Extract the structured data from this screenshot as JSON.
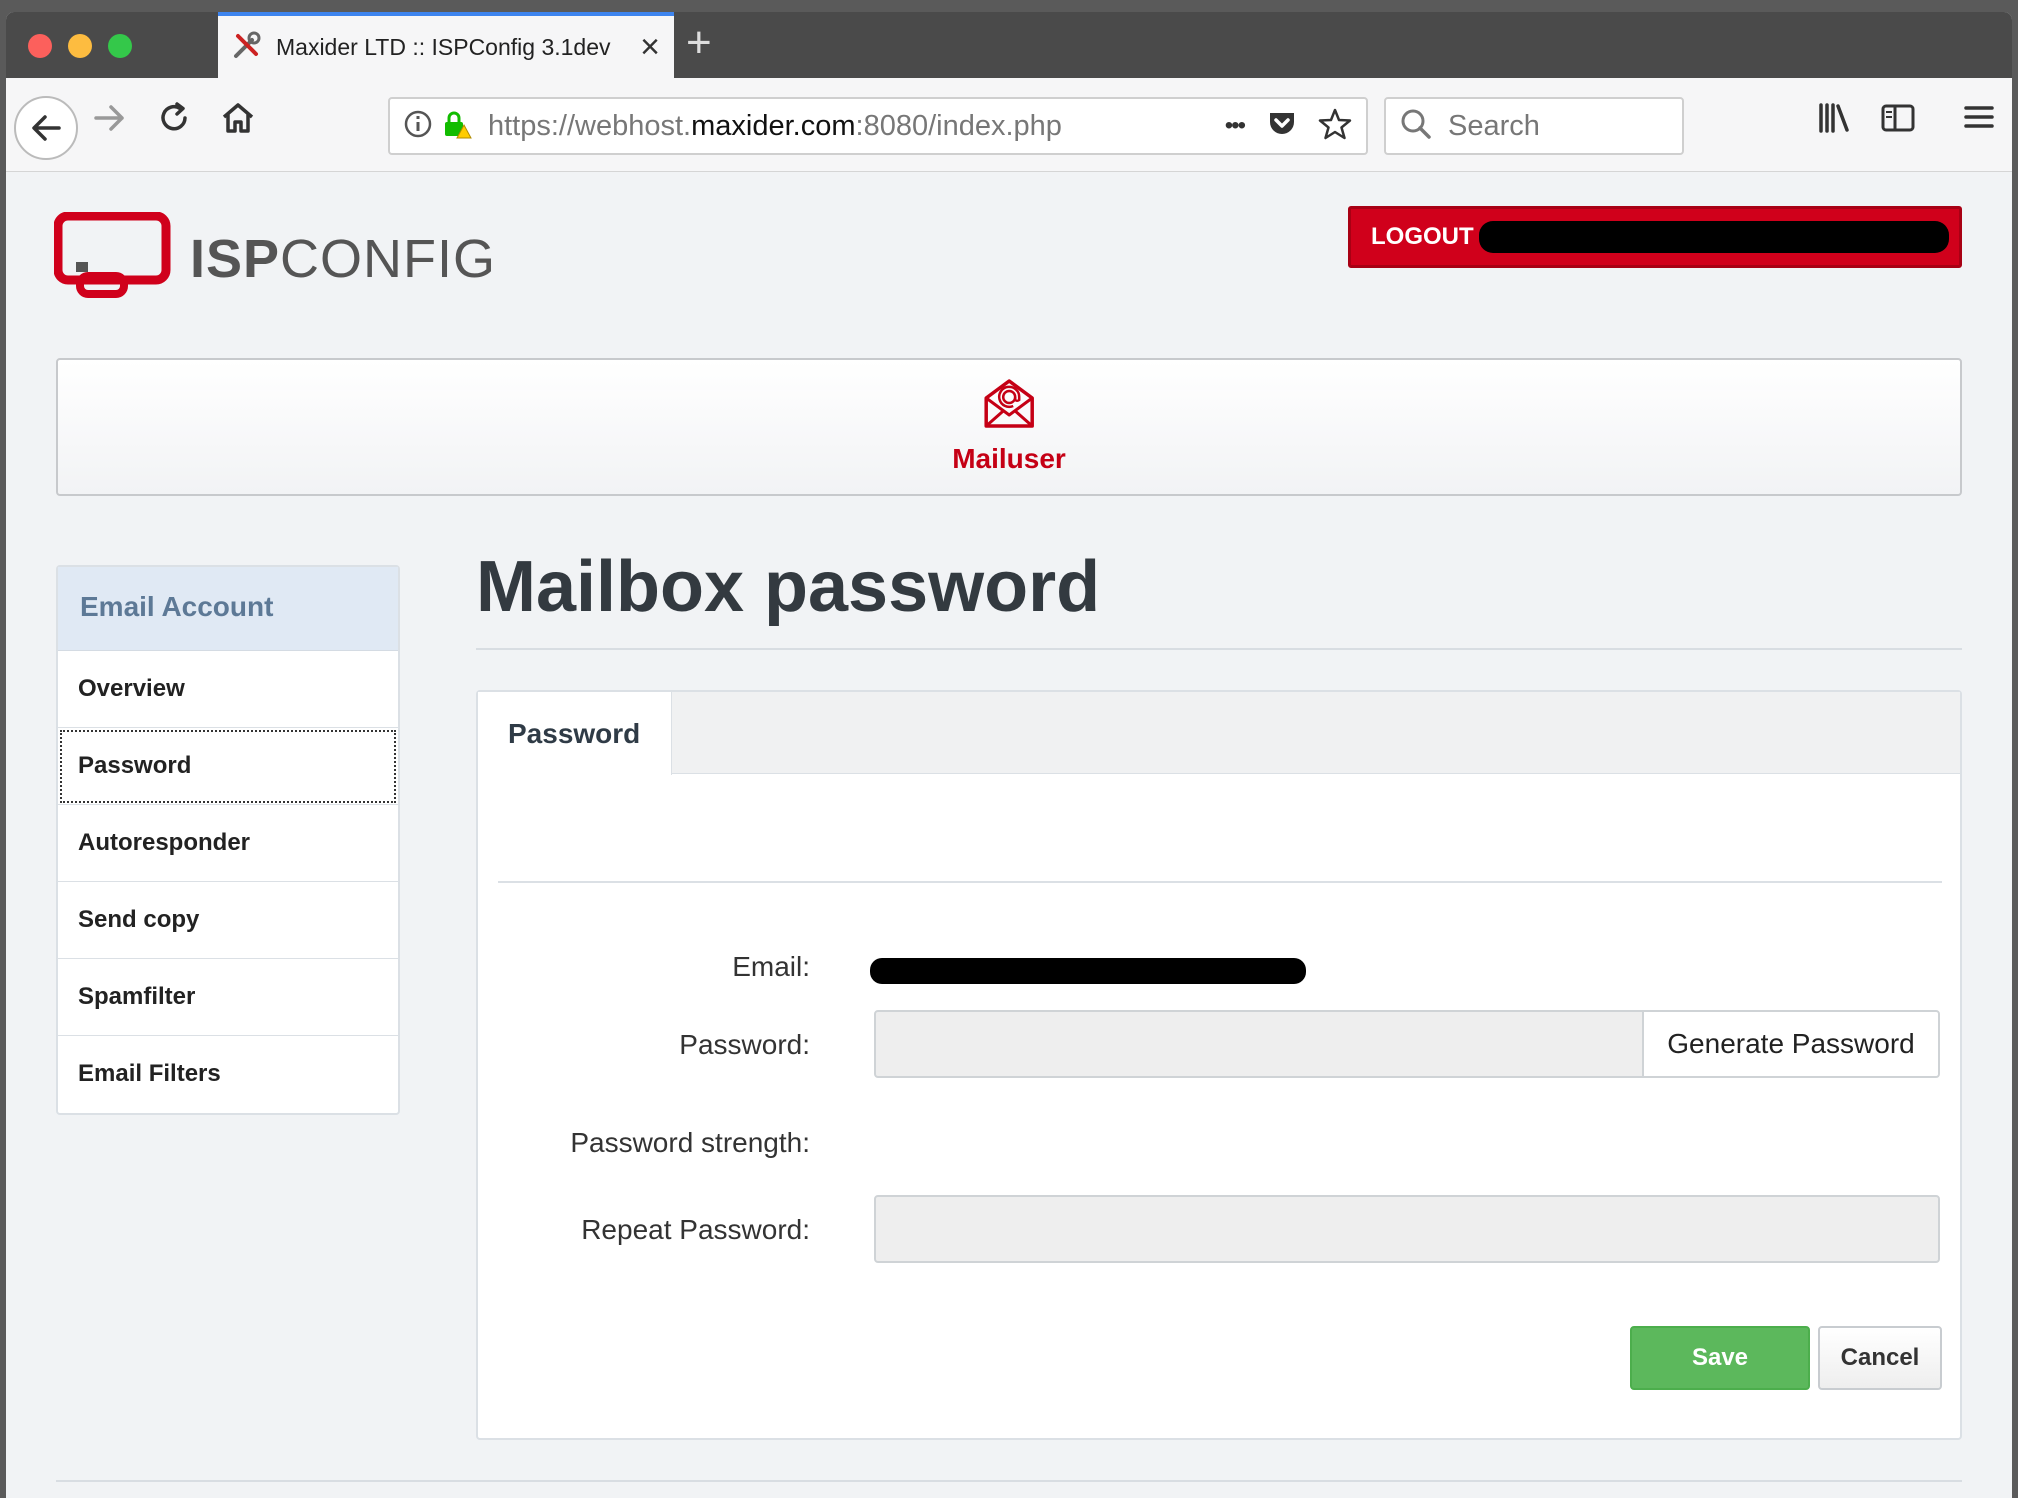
{
  "browser": {
    "tab_title": "Maxider LTD :: ISPConfig 3.1dev",
    "url_prefix": "https://webhost.",
    "url_domain": "maxider.com",
    "url_suffix": ":8080/index.php",
    "search_placeholder": "Search",
    "new_tab_label": "+",
    "page_actions": "•••"
  },
  "header": {
    "logo_bold": "ISP",
    "logo_light": "CONFIG",
    "logout_label": "LOGOUT"
  },
  "module": {
    "label": "Mailuser",
    "icon": "envelope-at-icon"
  },
  "sidebar": {
    "header": "Email Account",
    "items": [
      {
        "label": "Overview"
      },
      {
        "label": "Password"
      },
      {
        "label": "Autoresponder"
      },
      {
        "label": "Send copy"
      },
      {
        "label": "Spamfilter"
      },
      {
        "label": "Email Filters"
      }
    ]
  },
  "main": {
    "title": "Mailbox password",
    "tab_label": "Password",
    "form": {
      "email_label": "Email:",
      "password_label": "Password:",
      "generate_label": "Generate Password",
      "strength_label": "Password strength:",
      "repeat_label": "Repeat Password:",
      "save_label": "Save",
      "cancel_label": "Cancel"
    }
  },
  "colors": {
    "brand_red": "#d0001b",
    "save_green": "#5cb85c",
    "sidebar_header_bg": "#e0e9f4"
  }
}
